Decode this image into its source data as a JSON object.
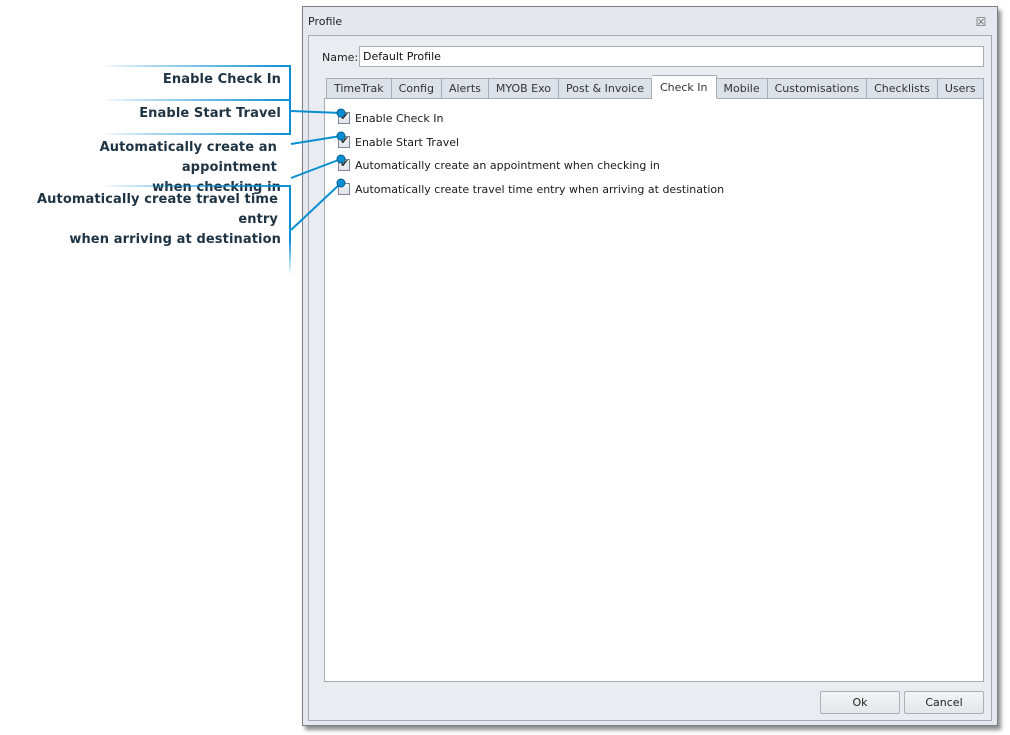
{
  "annotations": {
    "color": "#0a8fd3",
    "callouts": [
      {
        "text": "Enable Check In",
        "target_option": 0
      },
      {
        "text": "Enable Start Travel",
        "target_option": 1
      },
      {
        "text_line1": "Automatically create an appointment",
        "text_line2": "when checking in",
        "target_option": 2
      },
      {
        "text_line1": "Automatically create travel time entry",
        "text_line2": "when arriving at destination",
        "target_option": 3
      }
    ]
  },
  "dialog": {
    "title": "Profile",
    "close_icon": "close-icon",
    "name_label": "Name:",
    "name_value": "Default Profile",
    "tabs": [
      {
        "label": "TimeTrak",
        "active": false
      },
      {
        "label": "Config",
        "active": false
      },
      {
        "label": "Alerts",
        "active": false
      },
      {
        "label": "MYOB Exo",
        "active": false
      },
      {
        "label": "Post & Invoice",
        "active": false
      },
      {
        "label": "Check In",
        "active": true
      },
      {
        "label": "Mobile",
        "active": false
      },
      {
        "label": "Customisations",
        "active": false
      },
      {
        "label": "Checklists",
        "active": false
      },
      {
        "label": "Users",
        "active": false
      }
    ],
    "options": [
      {
        "label": "Enable Check In",
        "checked": true
      },
      {
        "label": "Enable Start Travel",
        "checked": true
      },
      {
        "label": "Automatically create an appointment when checking in",
        "checked": true
      },
      {
        "label": "Automatically create travel time entry when arriving at destination",
        "checked": false
      }
    ],
    "ok_label": "Ok",
    "cancel_label": "Cancel"
  }
}
